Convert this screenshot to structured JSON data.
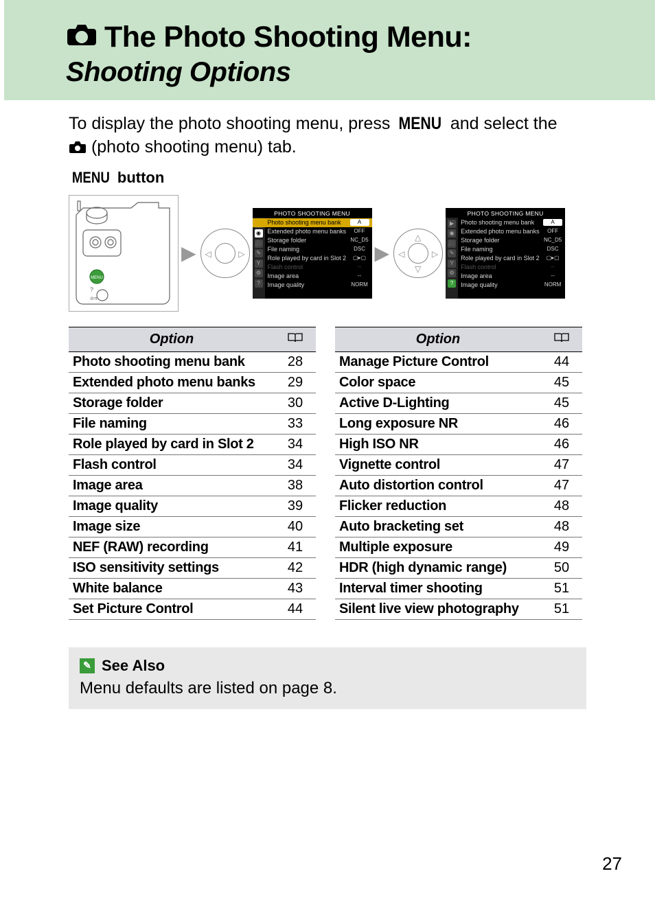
{
  "header": {
    "title_line1": "The Photo Shooting Menu:",
    "title_line2": "Shooting Options"
  },
  "intro": {
    "prefix": "To display the photo shooting menu, press ",
    "menu_word": "MENU",
    "middle": " and select the ",
    "suffix": " (photo shooting menu) tab."
  },
  "button_label": {
    "menu_word": "MENU",
    "suffix": " button"
  },
  "lcd": {
    "title": "PHOTO SHOOTING MENU",
    "rows": [
      {
        "label": "Photo shooting menu bank",
        "value": "A"
      },
      {
        "label": "Extended photo menu banks",
        "value": "OFF"
      },
      {
        "label": "Storage folder",
        "value": "NC_D5"
      },
      {
        "label": "File naming",
        "value": "DSC"
      },
      {
        "label": "Role played by card in Slot 2",
        "value": "▢▸▢"
      },
      {
        "label": "Flash control",
        "value": "--"
      },
      {
        "label": "Image area",
        "value": "--"
      },
      {
        "label": "Image quality",
        "value": "NORM"
      }
    ]
  },
  "tables": {
    "header_option": "Option",
    "left": [
      {
        "name": "Photo shooting menu bank",
        "page": "28"
      },
      {
        "name": "Extended photo menu banks",
        "page": "29"
      },
      {
        "name": "Storage folder",
        "page": "30"
      },
      {
        "name": "File naming",
        "page": "33"
      },
      {
        "name": "Role played by card in Slot 2",
        "page": "34"
      },
      {
        "name": "Flash control",
        "page": "34"
      },
      {
        "name": "Image area",
        "page": "38"
      },
      {
        "name": "Image quality",
        "page": "39"
      },
      {
        "name": "Image size",
        "page": "40"
      },
      {
        "name": "NEF (RAW) recording",
        "page": "41"
      },
      {
        "name": "ISO sensitivity settings",
        "page": "42"
      },
      {
        "name": "White balance",
        "page": "43"
      },
      {
        "name": "Set Picture Control",
        "page": "44"
      }
    ],
    "right": [
      {
        "name": "Manage Picture Control",
        "page": "44"
      },
      {
        "name": "Color space",
        "page": "45"
      },
      {
        "name": "Active D-Lighting",
        "page": "45"
      },
      {
        "name": "Long exposure NR",
        "page": "46"
      },
      {
        "name": "High ISO NR",
        "page": "46"
      },
      {
        "name": "Vignette control",
        "page": "47"
      },
      {
        "name": "Auto distortion control",
        "page": "47"
      },
      {
        "name": "Flicker reduction",
        "page": "48"
      },
      {
        "name": "Auto bracketing set",
        "page": "48"
      },
      {
        "name": "Multiple exposure",
        "page": "49"
      },
      {
        "name": "HDR (high dynamic range)",
        "page": "50"
      },
      {
        "name": "Interval timer shooting",
        "page": "51"
      },
      {
        "name": "Silent live view photography",
        "page": "51"
      }
    ]
  },
  "see_also": {
    "header": "See Also",
    "body": "Menu defaults are listed on page 8."
  },
  "page_number": "27"
}
